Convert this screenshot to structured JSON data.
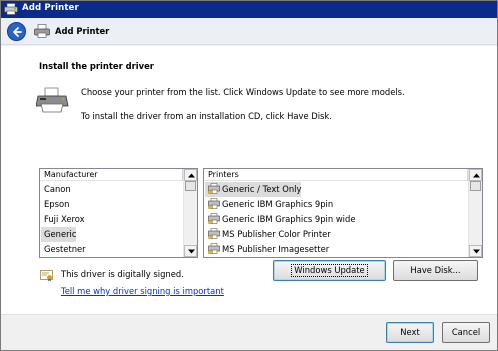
{
  "window": {
    "title": "Add Printer"
  },
  "nav": {
    "title": "Add Printer"
  },
  "page": {
    "heading": "Install the printer driver",
    "instruction_1": "Choose your printer from the list. Click Windows Update to see more models.",
    "instruction_2": "To install the driver from an installation CD, click Have Disk."
  },
  "manufacturers": {
    "header": "Manufacturer",
    "items": [
      "Canon",
      "Epson",
      "Fuji Xerox",
      "Generic",
      "Gestetner"
    ],
    "selected": "Generic"
  },
  "printers": {
    "header": "Printers",
    "items": [
      "Generic / Text Only",
      "Generic IBM Graphics 9pin",
      "Generic IBM Graphics 9pin wide",
      "MS Publisher Color Printer",
      "MS Publisher Imagesetter"
    ],
    "selected": "Generic / Text Only"
  },
  "signing": {
    "status_text": "This driver is digitally signed.",
    "link_text": "Tell me why driver signing is important"
  },
  "buttons": {
    "windows_update": "Windows Update",
    "have_disk": "Have Disk...",
    "next": "Next",
    "cancel": "Cancel"
  },
  "colors": {
    "titlebar": "#0b2a8a",
    "link": "#0033cc",
    "selection": "#dcdcdc"
  },
  "icons": {
    "title": "printer-icon",
    "back": "back-arrow-icon",
    "hero": "printer-install-icon",
    "signed": "certificate-icon"
  }
}
